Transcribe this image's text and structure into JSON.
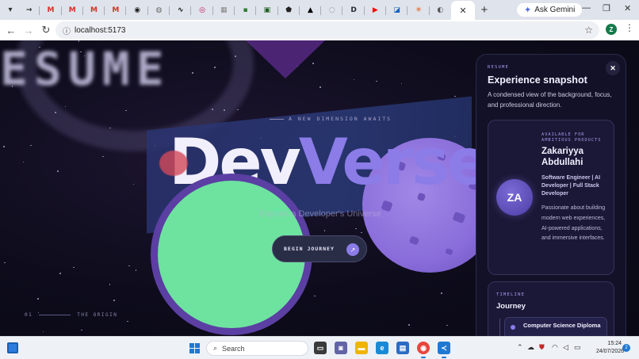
{
  "browser": {
    "tabs": [
      {
        "icon": "chevron-down-icon",
        "glyph": "▾"
      },
      {
        "icon": "arrow-icon",
        "glyph": "→",
        "color": "#2b2b2b"
      },
      {
        "icon": "gmail-icon",
        "glyph": "M",
        "color": "#d93025"
      },
      {
        "icon": "gmail-icon",
        "glyph": "M",
        "color": "#d93025"
      },
      {
        "icon": "gmail-icon",
        "glyph": "M",
        "color": "#d93025"
      },
      {
        "icon": "gmail-icon",
        "glyph": "M",
        "color": "#d93025"
      },
      {
        "icon": "github-icon",
        "glyph": "◉",
        "color": "#1f1f1f"
      },
      {
        "icon": "globe-icon",
        "glyph": "◍",
        "color": "#6b6b6b"
      },
      {
        "icon": "dev-icon",
        "glyph": "∿",
        "color": "#111111"
      },
      {
        "icon": "badge-icon",
        "glyph": "◎",
        "color": "#c2185b"
      },
      {
        "icon": "grid-icon",
        "glyph": "▦",
        "color": "#888888"
      },
      {
        "icon": "map-icon",
        "glyph": "▪",
        "color": "#2e7d32"
      },
      {
        "icon": "terminal-icon",
        "glyph": "▣",
        "color": "#1b5e20"
      },
      {
        "icon": "shield-icon",
        "glyph": "⬟",
        "color": "#222222"
      },
      {
        "icon": "arc-icon",
        "glyph": "▲",
        "color": "#000000"
      },
      {
        "icon": "settings-icon",
        "glyph": "◌",
        "color": "#777777"
      },
      {
        "icon": "d-icon",
        "glyph": "D",
        "color": "#24292f"
      },
      {
        "icon": "youtube-icon",
        "glyph": "▶",
        "color": "#ff0000"
      },
      {
        "icon": "chart-icon",
        "glyph": "◪",
        "color": "#1565c0"
      },
      {
        "icon": "sun-icon",
        "glyph": "✳",
        "color": "#e65100"
      },
      {
        "icon": "globe-icon",
        "glyph": "◐",
        "color": "#555555"
      }
    ],
    "active_tab_close": "✕",
    "new_tab": "+",
    "gemini_label": "Ask Gemini",
    "window_controls": {
      "minimize": "—",
      "restore": "❐",
      "close": "✕"
    },
    "url": "localhost:5173",
    "profile_initial": "Z"
  },
  "hero": {
    "blurred_word": "ESUME",
    "eyebrow": "A NEW DIMENSION AWAITS",
    "title_part1": "Dev",
    "title_part2": "Verse",
    "subtitle": "Explore a Developer's Universe",
    "cta_label": "BEGIN JOURNEY",
    "cta_icon": "↗",
    "section_number": "01",
    "section_label": "THE ORIGIN"
  },
  "resume": {
    "eyebrow": "RESUME",
    "title": "Experience snapshot",
    "description": "A condensed view of the background, focus, and professional direction.",
    "close": "✕",
    "profile": {
      "initials": "ZA",
      "tagline": "AVAILABLE FOR AMBITIOUS PRODUCTS",
      "name": "Zakariyya Abdullahi",
      "role": "Software Engineer | AI Developer | Full Stack Developer",
      "bio": "Passionate about building modern web experiences, AI-powered applications, and immersive interfaces."
    },
    "timeline": {
      "eyebrow": "TIMELINE",
      "title": "Journey",
      "items": [
        {
          "title": "Computer Science Diploma"
        }
      ]
    }
  },
  "taskbar": {
    "search_placeholder": "Search",
    "time": "15:24",
    "date": "24/07/2026",
    "notifications": "2",
    "colors": {
      "accent": "#1f78d1"
    }
  },
  "theme": {
    "accent": "#8b7ce8",
    "green_planet": "#6ee3a0",
    "purple_planet": "#8a6dda"
  }
}
